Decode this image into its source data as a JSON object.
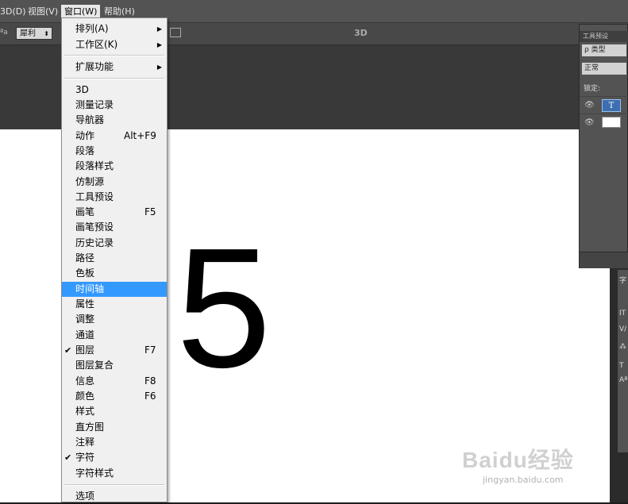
{
  "menubar": {
    "items": [
      {
        "label": "3D(D)"
      },
      {
        "label": "视图(V)"
      },
      {
        "label": "窗口(W)"
      },
      {
        "label": "帮助(H)"
      }
    ]
  },
  "options_bar": {
    "aa_small": "ªa",
    "aa_select": "犀利",
    "three_d": "3D"
  },
  "canvas": {
    "text": "5",
    "background": "#ffffff"
  },
  "layers_panel": {
    "tab": "工具预设",
    "kind_filter": "ρ 类型",
    "blend_mode": "正常",
    "lock_label": "锁定:",
    "text_layer_thumb": "T"
  },
  "char_panel": {
    "glyphs": [
      "字",
      "IT",
      "V/",
      "⁂",
      "T",
      "Aª"
    ]
  },
  "window_menu": {
    "items": [
      {
        "label": "排列(A)",
        "submenu": true
      },
      {
        "label": "工作区(K)",
        "submenu": true
      },
      {
        "label": "扩展功能",
        "submenu": true
      },
      {
        "label": "3D"
      },
      {
        "label": "测量记录"
      },
      {
        "label": "导航器"
      },
      {
        "label": "动作",
        "shortcut": "Alt+F9"
      },
      {
        "label": "段落"
      },
      {
        "label": "段落样式"
      },
      {
        "label": "仿制源"
      },
      {
        "label": "工具预设"
      },
      {
        "label": "画笔",
        "shortcut": "F5"
      },
      {
        "label": "画笔预设"
      },
      {
        "label": "历史记录"
      },
      {
        "label": "路径"
      },
      {
        "label": "色板"
      },
      {
        "label": "时间轴",
        "highlighted": true
      },
      {
        "label": "属性"
      },
      {
        "label": "调整"
      },
      {
        "label": "通道"
      },
      {
        "label": "图层",
        "shortcut": "F7",
        "checked": true
      },
      {
        "label": "图层复合"
      },
      {
        "label": "信息",
        "shortcut": "F8"
      },
      {
        "label": "颜色",
        "shortcut": "F6"
      },
      {
        "label": "样式"
      },
      {
        "label": "直方图"
      },
      {
        "label": "注释"
      },
      {
        "label": "字符",
        "checked": true
      },
      {
        "label": "字符样式"
      },
      {
        "label": "选项"
      }
    ],
    "check_glyph": "✔",
    "submenu_glyph": "▶"
  },
  "watermark": {
    "logo": "Baidu经验",
    "url": "jingyan.baidu.com"
  }
}
